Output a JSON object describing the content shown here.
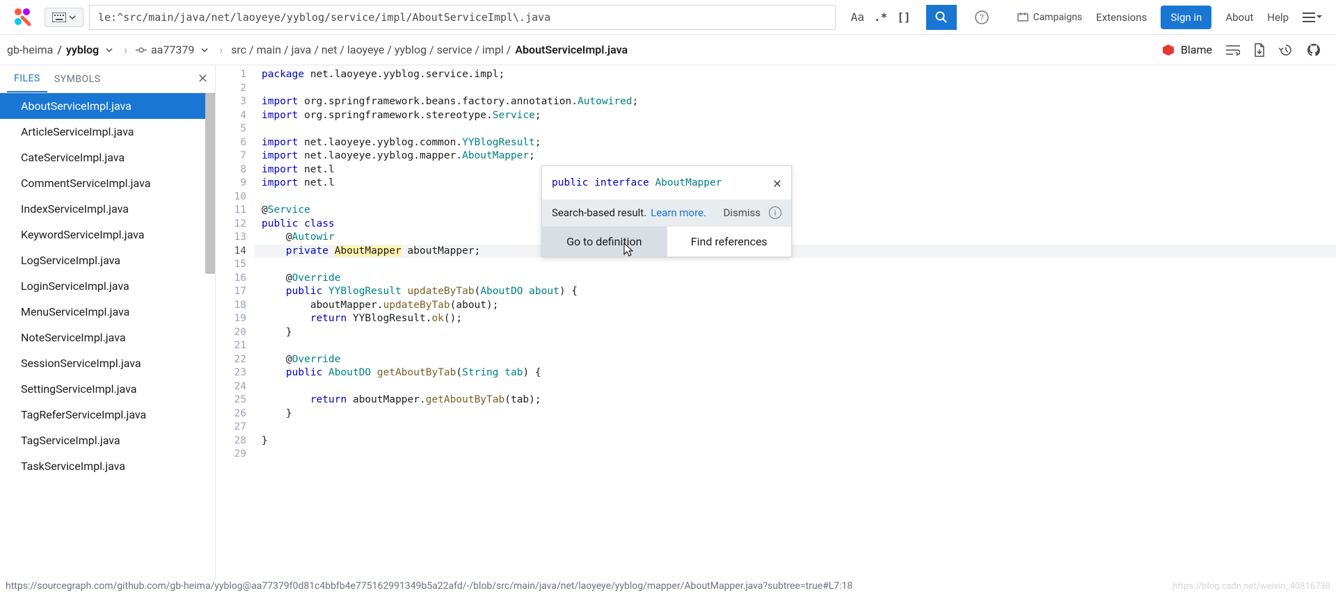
{
  "header": {
    "search_value": "le:^src/main/java/net/laoyeye/yyblog/service/impl/AboutServiceImpl\\.java",
    "toggle_case": "Aa",
    "toggle_regex": ".*",
    "toggle_brackets": "[]",
    "campaigns": "Campaigns",
    "extensions": "Extensions",
    "sign_in": "Sign in",
    "about": "About",
    "help": "Help"
  },
  "breadcrumb": {
    "owner": "gb-heima",
    "repo": "yyblog",
    "commit": "aa77379",
    "path_segments": [
      "src",
      "main",
      "java",
      "net",
      "laoyeye",
      "yyblog",
      "service",
      "impl"
    ],
    "file": "AboutServiceImpl.java",
    "blame": "Blame"
  },
  "sidebar": {
    "tabs": {
      "files": "FILES",
      "symbols": "SYMBOLS"
    },
    "files": [
      "AboutServiceImpl.java",
      "ArticleServiceImpl.java",
      "CateServiceImpl.java",
      "CommentServiceImpl.java",
      "IndexServiceImpl.java",
      "KeywordServiceImpl.java",
      "LogServiceImpl.java",
      "LoginServiceImpl.java",
      "MenuServiceImpl.java",
      "NoteServiceImpl.java",
      "SessionServiceImpl.java",
      "SettingServiceImpl.java",
      "TagReferServiceImpl.java",
      "TagServiceImpl.java",
      "TaskServiceImpl.java"
    ]
  },
  "hover": {
    "signature_kw1": "public",
    "signature_kw2": "interface",
    "signature_name": "AboutMapper",
    "search_based": "Search-based result.",
    "learn_more": "Learn more.",
    "dismiss": "Dismiss",
    "go_def": "Go to definition",
    "find_refs": "Find references"
  },
  "code": {
    "lines": [
      {
        "n": 1,
        "tokens": [
          [
            "kw",
            "package"
          ],
          [
            "",
            " net.laoyeye.yyblog.service.impl;"
          ]
        ]
      },
      {
        "n": 2,
        "tokens": []
      },
      {
        "n": 3,
        "tokens": [
          [
            "kw",
            "import"
          ],
          [
            "",
            " org.springframework.beans.factory.annotation."
          ],
          [
            "typ",
            "Autowired"
          ],
          [
            "",
            ";"
          ]
        ]
      },
      {
        "n": 4,
        "tokens": [
          [
            "kw",
            "import"
          ],
          [
            "",
            " org.springframework.stereotype."
          ],
          [
            "typ",
            "Service"
          ],
          [
            "",
            ";"
          ]
        ]
      },
      {
        "n": 5,
        "tokens": []
      },
      {
        "n": 6,
        "tokens": [
          [
            "kw",
            "import"
          ],
          [
            "",
            " net.laoyeye.yyblog.common."
          ],
          [
            "typ",
            "YYBlogResult"
          ],
          [
            "",
            ";"
          ]
        ]
      },
      {
        "n": 7,
        "tokens": [
          [
            "kw",
            "import"
          ],
          [
            "",
            " net.laoyeye.yyblog.mapper."
          ],
          [
            "typ",
            "AboutMapper"
          ],
          [
            "",
            ";"
          ]
        ]
      },
      {
        "n": 8,
        "tokens": [
          [
            "kw",
            "import"
          ],
          [
            "",
            " net.l"
          ]
        ]
      },
      {
        "n": 9,
        "tokens": [
          [
            "kw",
            "import"
          ],
          [
            "",
            " net.l"
          ]
        ]
      },
      {
        "n": 10,
        "tokens": []
      },
      {
        "n": 11,
        "tokens": [
          [
            "",
            "@"
          ],
          [
            "ann",
            "Service"
          ]
        ]
      },
      {
        "n": 12,
        "tokens": [
          [
            "kw",
            "public"
          ],
          [
            "",
            " "
          ],
          [
            "kw",
            "class"
          ]
        ]
      },
      {
        "n": 13,
        "tokens": [
          [
            "",
            "    @"
          ],
          [
            "ann",
            "Autowir"
          ]
        ]
      },
      {
        "n": 14,
        "hl": true,
        "tokens": [
          [
            "",
            "    "
          ],
          [
            "kw",
            "private"
          ],
          [
            "",
            " "
          ],
          [
            "hl",
            "AboutMapper"
          ],
          [
            "",
            " aboutMapper;"
          ]
        ]
      },
      {
        "n": 15,
        "tokens": []
      },
      {
        "n": 16,
        "tokens": [
          [
            "",
            "    @"
          ],
          [
            "ann",
            "Override"
          ]
        ]
      },
      {
        "n": 17,
        "tokens": [
          [
            "",
            "    "
          ],
          [
            "kw",
            "public"
          ],
          [
            "",
            " "
          ],
          [
            "typ",
            "YYBlogResult"
          ],
          [
            "",
            " "
          ],
          [
            "fn",
            "updateByTab"
          ],
          [
            "",
            "("
          ],
          [
            "typ",
            "AboutDO"
          ],
          [
            "",
            " "
          ],
          [
            "str",
            "about"
          ],
          [
            "",
            ") {"
          ]
        ]
      },
      {
        "n": 18,
        "tokens": [
          [
            "",
            "        aboutMapper."
          ],
          [
            "fn",
            "updateByTab"
          ],
          [
            "",
            "(about);"
          ]
        ]
      },
      {
        "n": 19,
        "tokens": [
          [
            "",
            "        "
          ],
          [
            "kw",
            "return"
          ],
          [
            "",
            " YYBlogResult."
          ],
          [
            "fn",
            "ok"
          ],
          [
            "",
            "();"
          ]
        ]
      },
      {
        "n": 20,
        "tokens": [
          [
            "",
            "    }"
          ]
        ]
      },
      {
        "n": 21,
        "tokens": []
      },
      {
        "n": 22,
        "tokens": [
          [
            "",
            "    @"
          ],
          [
            "ann",
            "Override"
          ]
        ]
      },
      {
        "n": 23,
        "tokens": [
          [
            "",
            "    "
          ],
          [
            "kw",
            "public"
          ],
          [
            "",
            " "
          ],
          [
            "typ",
            "AboutDO"
          ],
          [
            "",
            " "
          ],
          [
            "fn",
            "getAboutByTab"
          ],
          [
            "",
            "("
          ],
          [
            "typ",
            "String"
          ],
          [
            "",
            " "
          ],
          [
            "str",
            "tab"
          ],
          [
            "",
            ") {"
          ]
        ]
      },
      {
        "n": 24,
        "tokens": []
      },
      {
        "n": 25,
        "tokens": [
          [
            "",
            "        "
          ],
          [
            "kw",
            "return"
          ],
          [
            "",
            " aboutMapper."
          ],
          [
            "fn",
            "getAboutByTab"
          ],
          [
            "",
            "(tab);"
          ]
        ]
      },
      {
        "n": 26,
        "tokens": [
          [
            "",
            "    }"
          ]
        ]
      },
      {
        "n": 27,
        "tokens": []
      },
      {
        "n": 28,
        "tokens": [
          [
            "",
            "}"
          ]
        ]
      },
      {
        "n": 29,
        "tokens": []
      }
    ]
  },
  "status": {
    "url": "https://sourcegraph.com/github.com/gb-heima/yyblog@aa77379f0d81c4bbfb4e775162991349b5a22afd/-/blob/src/main/java/net/laoyeye/yyblog/mapper/AboutMapper.java?subtree=true#L7:18",
    "watermark": "https://blog.csdn.net/weixin_40816738"
  }
}
